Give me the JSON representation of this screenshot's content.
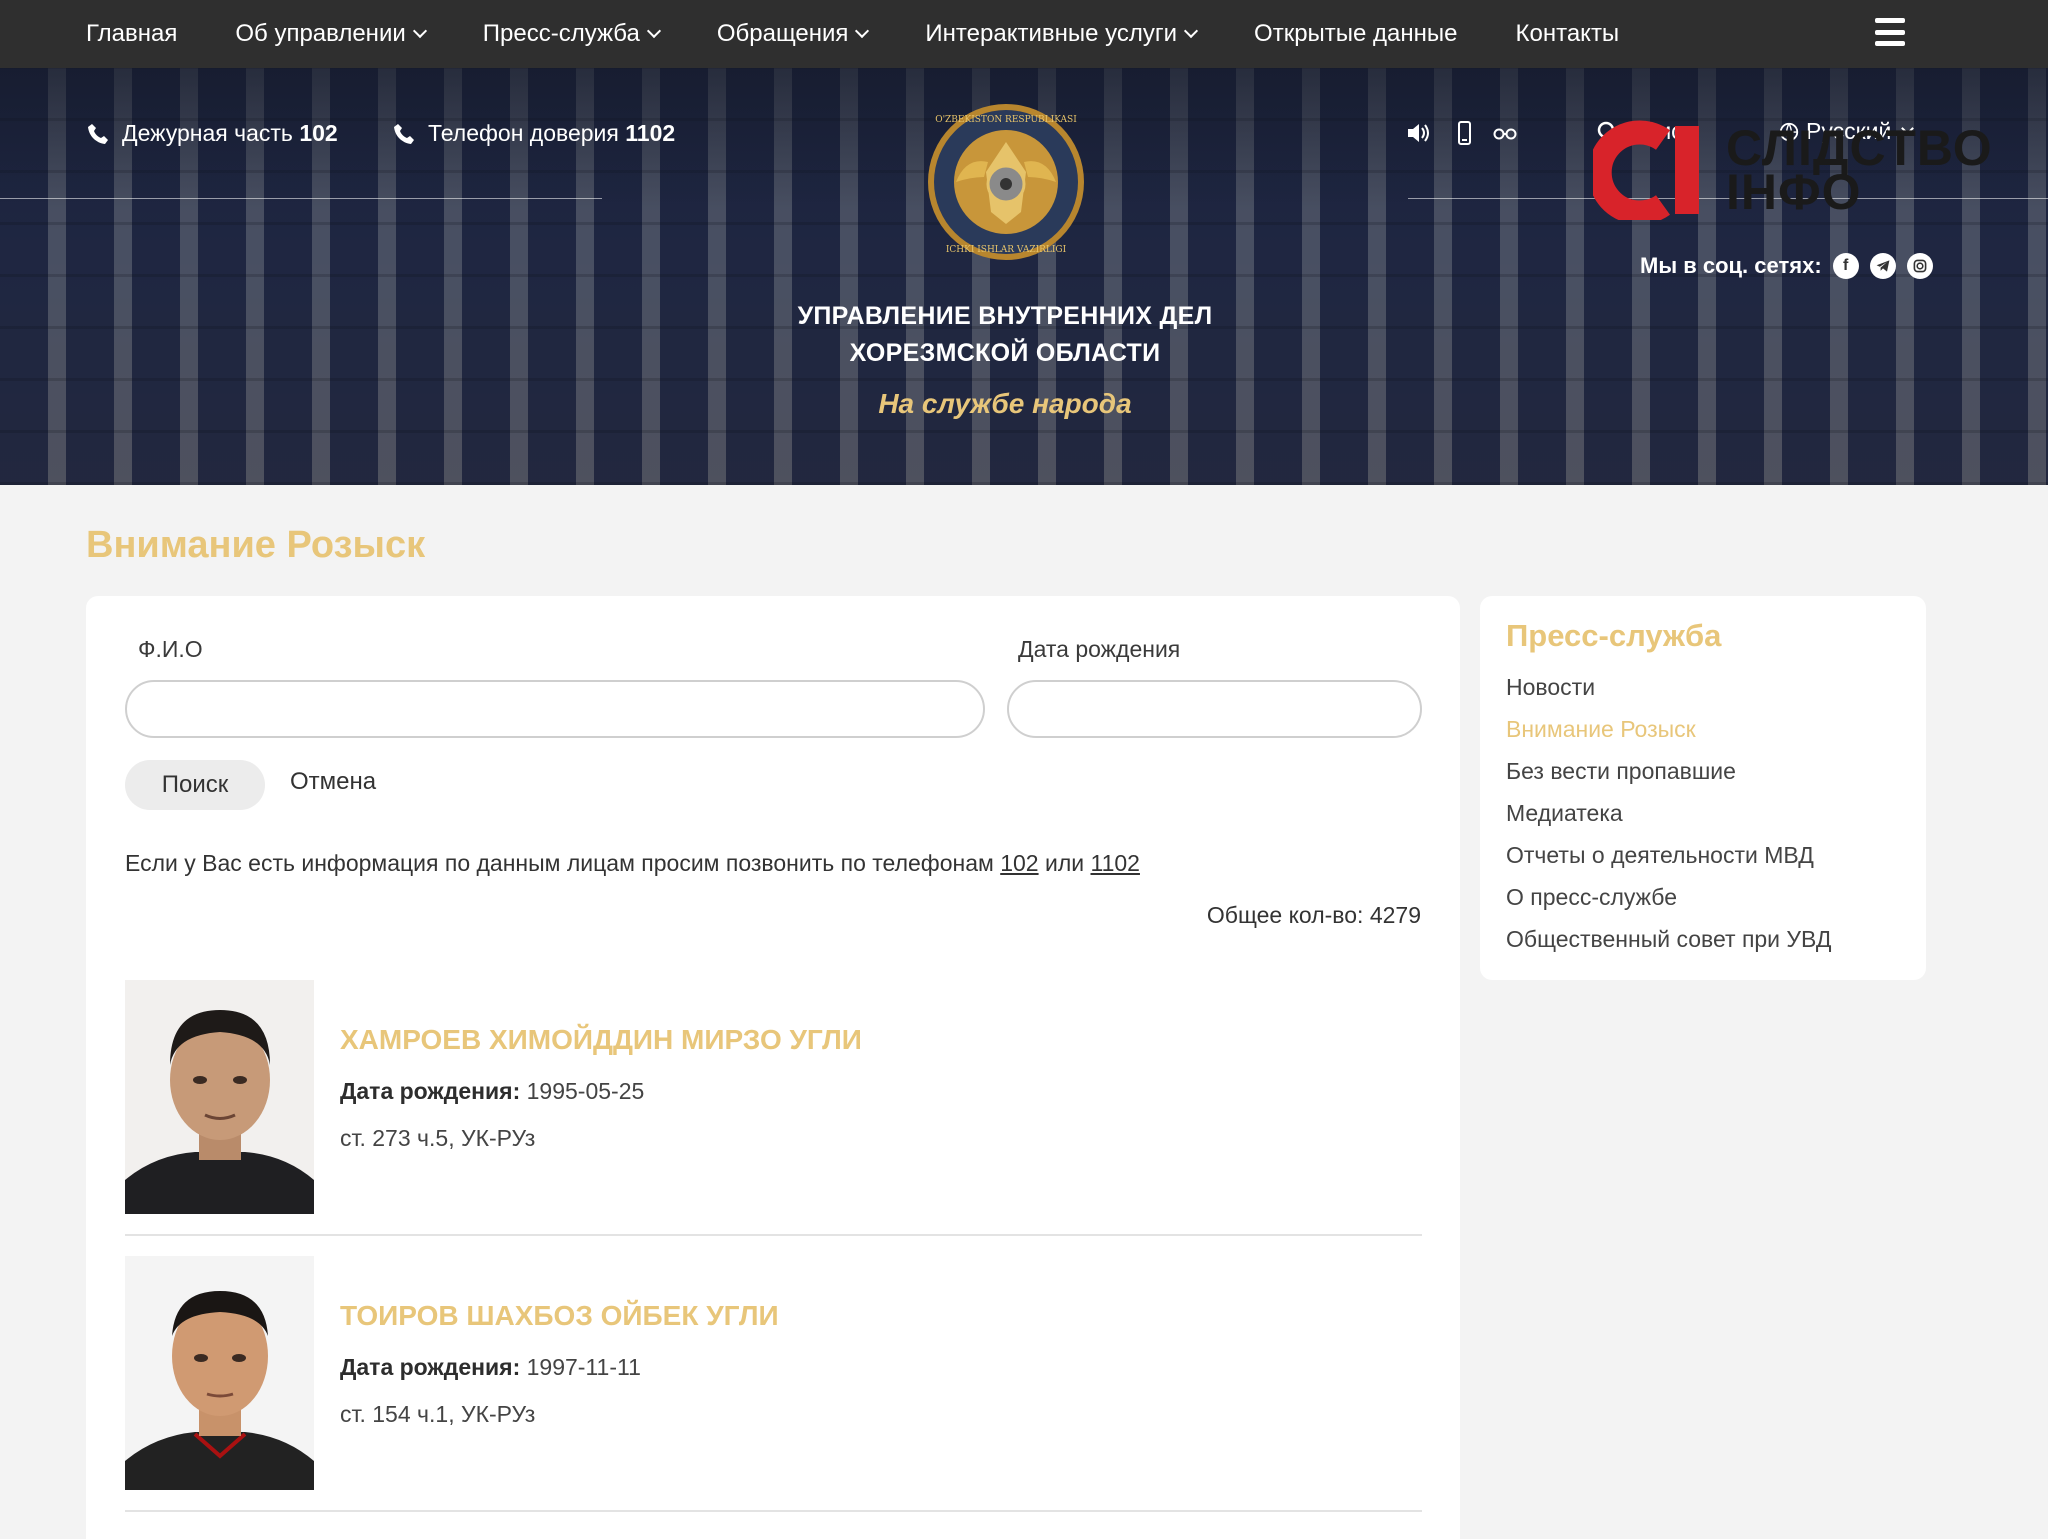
{
  "nav": {
    "items": [
      {
        "label": "Главная",
        "has_dropdown": false
      },
      {
        "label": "Об управлении",
        "has_dropdown": true
      },
      {
        "label": "Пресс-служба",
        "has_dropdown": true
      },
      {
        "label": "Обращения",
        "has_dropdown": true
      },
      {
        "label": "Интерактивные услуги",
        "has_dropdown": true
      },
      {
        "label": "Открытые данные",
        "has_dropdown": false
      },
      {
        "label": "Контакты",
        "has_dropdown": false
      }
    ]
  },
  "header": {
    "duty_label": "Дежурная часть",
    "duty_number": "102",
    "trust_label": "Телефон доверия",
    "trust_number": "1102",
    "search_placeholder": "Поиск",
    "language": "Русский",
    "org_line1": "УПРАВЛЕНИЕ ВНУТРЕННИХ ДЕЛ",
    "org_line2": "ХОРЕЗМСКОЙ ОБЛАСТИ",
    "slogan": "На службе народа",
    "social_label": "Мы в соц. сетях:",
    "emblem_text_top": "O'ZBEKISTON RESPUBLIKASI",
    "emblem_text_bottom": "ICHKI ISHLAR VAZIRLIGI"
  },
  "watermark": {
    "line1": "СЛІДСТВО",
    "line2": "ІНФО",
    "mark": "СІ"
  },
  "main": {
    "title": "Внимание Розыск",
    "form": {
      "name_label": "Ф.И.О",
      "name_value": "",
      "dob_label": "Дата рождения",
      "dob_value": "",
      "search_button": "Поиск",
      "cancel_button": "Отмена"
    },
    "info": {
      "text": "Если у Вас есть информация по данным лицам просим позвонить по телефонам",
      "phone1": "102",
      "or": "или",
      "phone2": "1102"
    },
    "total_label": "Общее кол-во:",
    "total_value": "4279",
    "dob_field_label": "Дата рождения:",
    "people": [
      {
        "name": "ХАМРОЕВ ХИМОЙДДИН МИРЗО УГЛИ",
        "dob": "1995-05-25",
        "article": "ст. 273 ч.5, УК-РУз"
      },
      {
        "name": "ТОИРОВ ШАХБОЗ ОЙБЕК УГЛИ",
        "dob": "1997-11-11",
        "article": "ст. 154 ч.1, УК-РУз"
      }
    ]
  },
  "sidebar": {
    "title": "Пресс-служба",
    "items": [
      {
        "label": "Новости",
        "active": false
      },
      {
        "label": "Внимание Розыск",
        "active": true
      },
      {
        "label": "Без вести пропавшие",
        "active": false
      },
      {
        "label": "Медиатека",
        "active": false
      },
      {
        "label": "Отчеты о деятельности МВД",
        "active": false
      },
      {
        "label": "О пресс-службе",
        "active": false
      },
      {
        "label": "Общественный совет при УВД",
        "active": false
      }
    ]
  },
  "colors": {
    "accent": "#e8c67a",
    "nav_bg": "#2f2f2f",
    "watermark_red": "#d8232a"
  }
}
